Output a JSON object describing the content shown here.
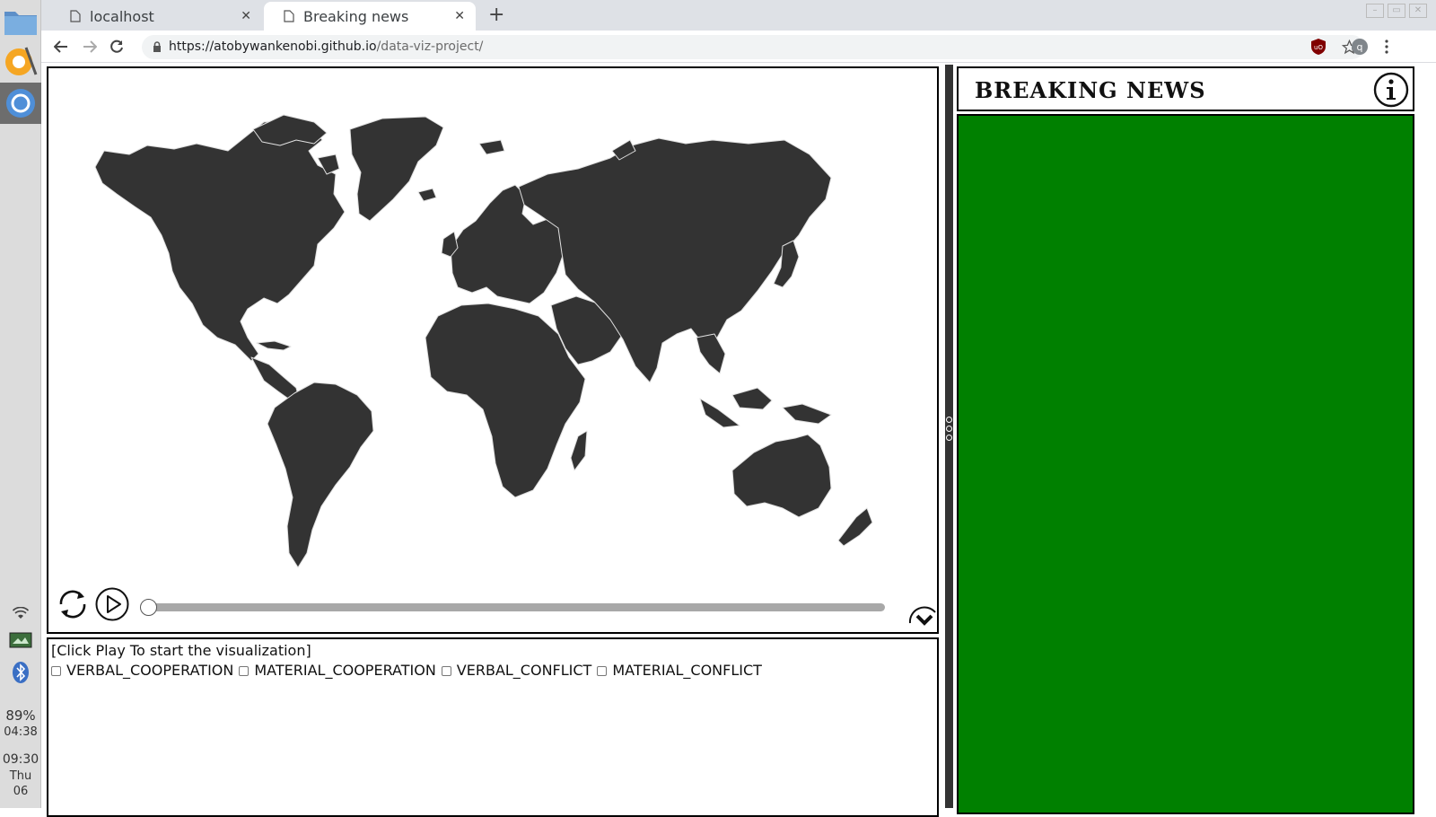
{
  "dock": {
    "battery": "89%",
    "battery_time": "04:38",
    "clock_time": "09:30",
    "clock_day": "Thu",
    "clock_date": "06"
  },
  "browser": {
    "tabs": [
      {
        "title": "localhost",
        "active": false
      },
      {
        "title": "Breaking news",
        "active": true
      }
    ],
    "url_host": "https://atobywankenobi.github.io",
    "url_path": "/data-viz-project/",
    "profile_initial": "q",
    "extension_badge": "uO"
  },
  "page": {
    "status": "[Click Play To start the visualization]",
    "filters": [
      {
        "label": "VERBAL_COOPERATION",
        "checked": false
      },
      {
        "label": "MATERIAL_COOPERATION",
        "checked": false
      },
      {
        "label": "VERBAL_CONFLICT",
        "checked": false
      },
      {
        "label": "MATERIAL_CONFLICT",
        "checked": false
      }
    ],
    "timeline_progress": 0,
    "news_title": "BREAKING NEWS",
    "colors": {
      "land": "#333333",
      "border": "#e0e0e0",
      "news_bg": "#008000"
    }
  }
}
